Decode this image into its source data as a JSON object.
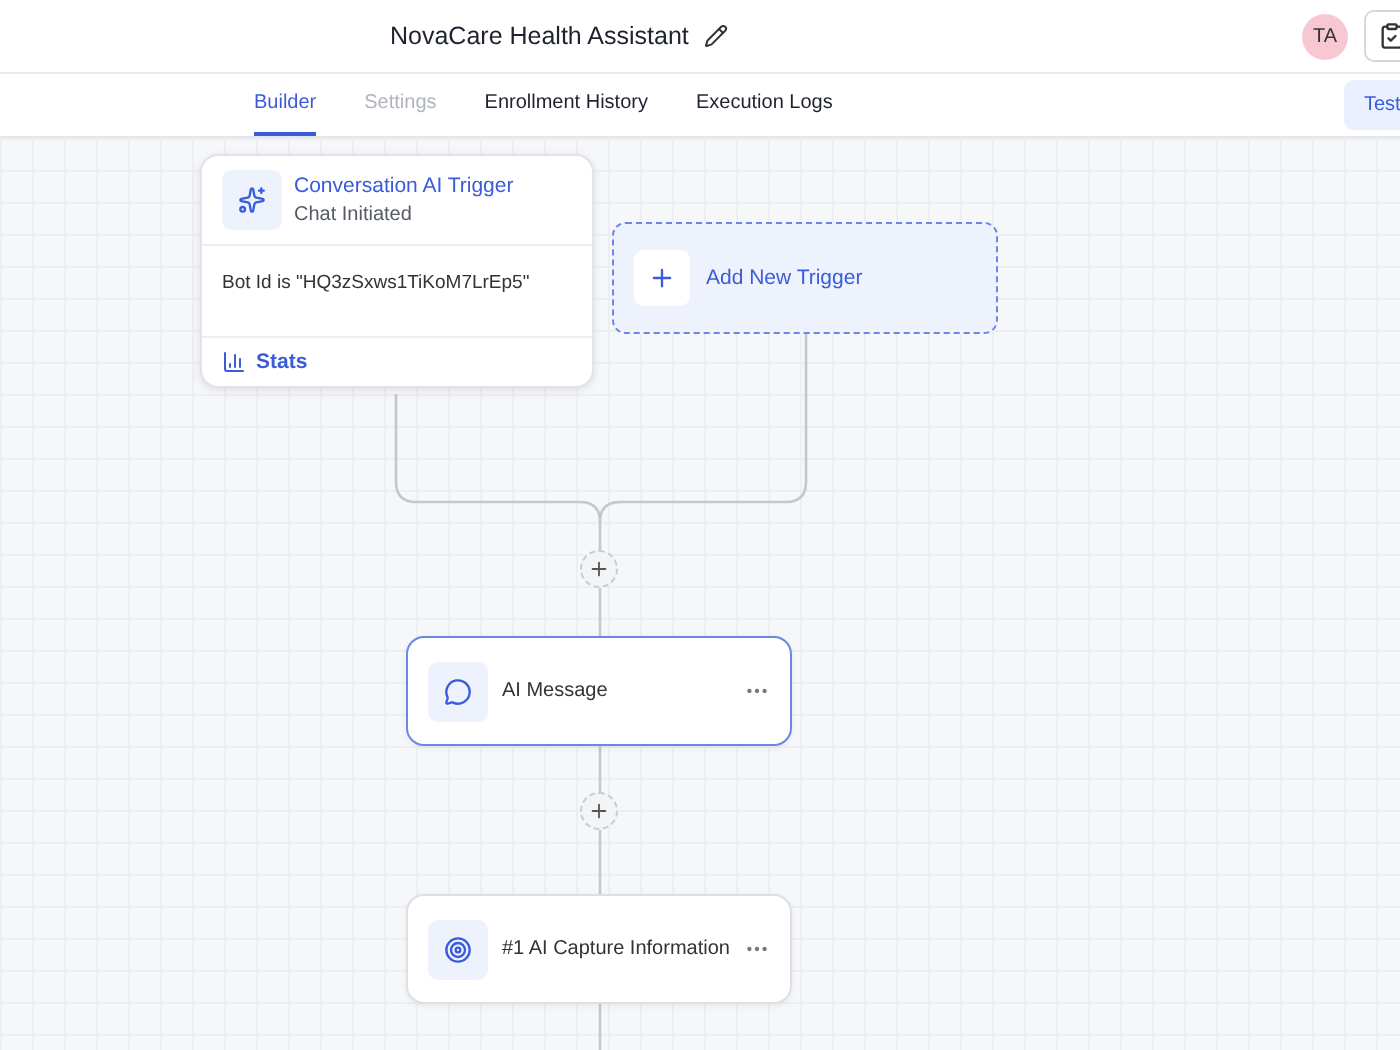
{
  "header": {
    "title": "NovaCare Health Assistant",
    "avatar": "TA"
  },
  "tabs": [
    {
      "label": "Builder",
      "selected": true,
      "disabled": false
    },
    {
      "label": "Settings",
      "selected": false,
      "disabled": true
    },
    {
      "label": "Enrollment History",
      "selected": false,
      "disabled": false
    },
    {
      "label": "Execution Logs",
      "selected": false,
      "disabled": false
    }
  ],
  "test_button": "Test",
  "trigger": {
    "title": "Conversation AI Trigger",
    "subtitle": "Chat Initiated",
    "condition": "Bot Id is \"HQ3zSxws1TiKoM7LrEp5\"",
    "stats": "Stats"
  },
  "add_trigger": "Add New Trigger",
  "actions": [
    {
      "label": "AI Message",
      "selected": true,
      "kind": "message"
    },
    {
      "label": "#1 AI Capture Information",
      "selected": false,
      "kind": "capture"
    }
  ]
}
